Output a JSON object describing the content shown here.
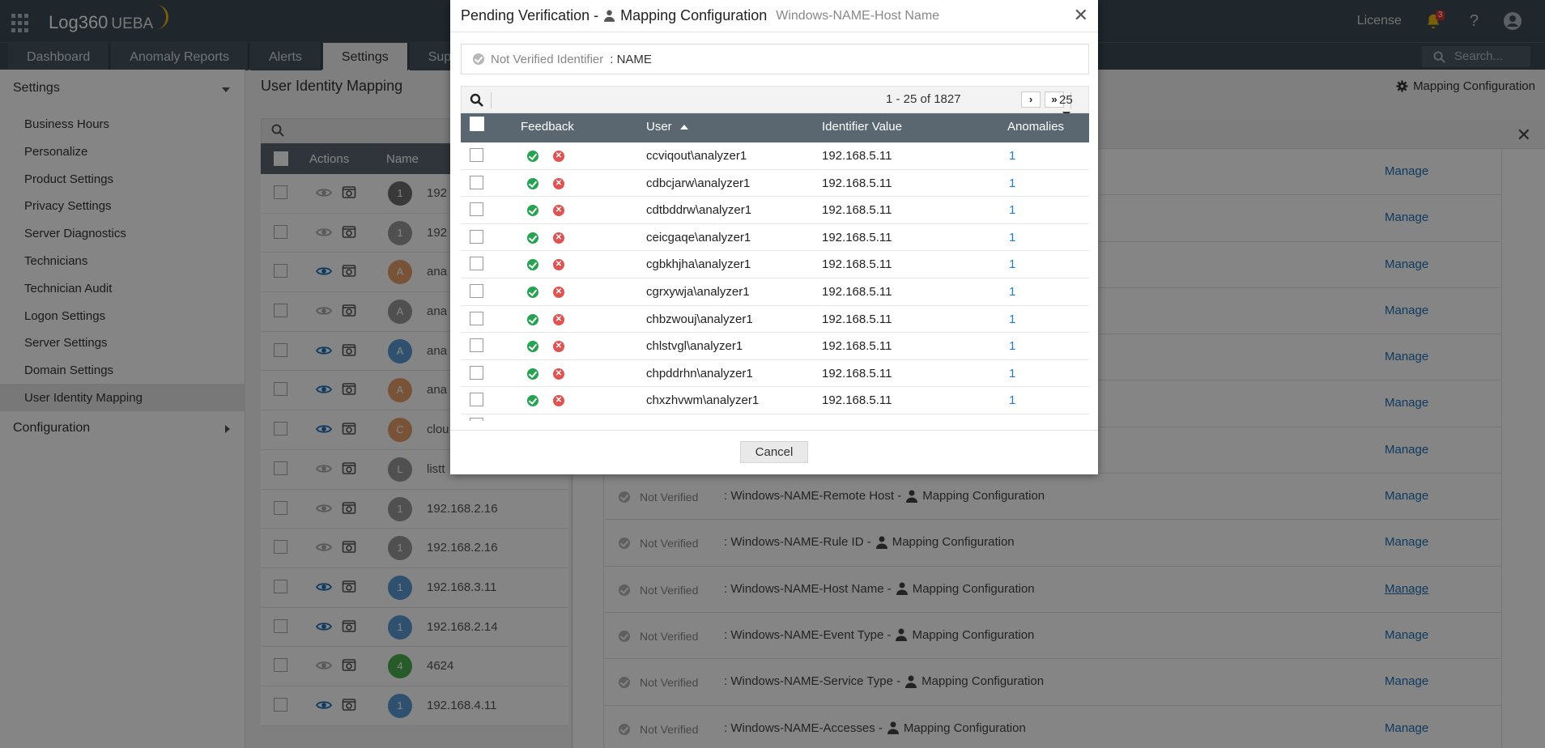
{
  "app": {
    "brand": "Log360",
    "brand_suffix": "UEBA"
  },
  "topbar": {
    "license": "License",
    "notification_count": "3",
    "help": "?"
  },
  "nav": {
    "tabs": [
      "Dashboard",
      "Anomaly Reports",
      "Alerts",
      "Settings",
      "Sup"
    ],
    "active": "Settings",
    "search_placeholder": "Search..."
  },
  "sidebar": {
    "heading": "Settings",
    "items": [
      "Business Hours",
      "Personalize",
      "Product Settings",
      "Privacy Settings",
      "Server Diagnostics",
      "Technicians",
      "Technician Audit",
      "Logon Settings",
      "Server Settings",
      "Domain Settings",
      "User Identity Mapping"
    ],
    "active_item": "User Identity Mapping",
    "configuration": "Configuration"
  },
  "main": {
    "title": "User Identity Mapping",
    "mapping_config_link": "Mapping Configuration",
    "grid_headers": {
      "actions": "Actions",
      "name": "Name"
    },
    "grid_rows": [
      {
        "avatar": "1",
        "name": "192",
        "color": "#6d6d6d"
      },
      {
        "avatar": "1",
        "name": "192",
        "color": "#9a9a9a"
      },
      {
        "avatar": "A",
        "name": "ana",
        "color": "#e8a06c"
      },
      {
        "avatar": "A",
        "name": "ana",
        "color": "#9a9a9a"
      },
      {
        "avatar": "A",
        "name": "ana",
        "color": "#5b9bd5"
      },
      {
        "avatar": "A",
        "name": "ana",
        "color": "#e8a06c"
      },
      {
        "avatar": "C",
        "name": "clou",
        "color": "#e8a06c"
      },
      {
        "avatar": "L",
        "name": "listt",
        "color": "#9a9a9a"
      },
      {
        "avatar": "1",
        "name": "192.168.2.16",
        "color": "#9a9a9a"
      },
      {
        "avatar": "1",
        "name": "192.168.2.16",
        "color": "#9a9a9a"
      },
      {
        "avatar": "1",
        "name": "192.168.3.11",
        "color": "#5b9bd5"
      },
      {
        "avatar": "1",
        "name": "192.168.2.14",
        "color": "#5b9bd5"
      },
      {
        "avatar": "4",
        "name": "4624",
        "color": "#4caf50"
      },
      {
        "avatar": "1",
        "name": "192.168.4.11",
        "color": "#5b9bd5"
      }
    ]
  },
  "drawer": {
    "status_label": "Not Verified",
    "manage_label": "Manage",
    "rows": [
      {
        "identifier": "",
        "config": ""
      },
      {
        "identifier": "",
        "config": ""
      },
      {
        "identifier": "",
        "config": ""
      },
      {
        "identifier": "",
        "config": ""
      },
      {
        "identifier": "",
        "config": ""
      },
      {
        "identifier": "",
        "config": ""
      },
      {
        "identifier": "",
        "config": ""
      },
      {
        "identifier": ": Windows-NAME-Remote Host -",
        "config": "Mapping Configuration"
      },
      {
        "identifier": ": Windows-NAME-Rule ID -",
        "config": "Mapping Configuration"
      },
      {
        "identifier": ": Windows-NAME-Host Name -",
        "config": "Mapping Configuration"
      },
      {
        "identifier": ": Windows-NAME-Event Type -",
        "config": "Mapping Configuration"
      },
      {
        "identifier": ": Windows-NAME-Service Type -",
        "config": "Mapping Configuration"
      },
      {
        "identifier": ": Windows-NAME-Accesses -",
        "config": "Mapping Configuration"
      }
    ]
  },
  "modal": {
    "title": "Pending Verification -",
    "title_config": "Mapping Configuration",
    "subtitle": "Windows-NAME-Host Name",
    "identifier_label": "Not Verified Identifier",
    "identifier_value": ": NAME",
    "range": "1 - 25 of 1827",
    "next": "›",
    "last": "»",
    "page_size": "25",
    "headers": {
      "feedback": "Feedback",
      "user": "User",
      "identifier": "Identifier Value",
      "anomalies": "Anomalies"
    },
    "rows": [
      {
        "user": "ccviqout\\analyzer1",
        "ip": "192.168.5.11",
        "anomalies": "1"
      },
      {
        "user": "cdbcjarw\\analyzer1",
        "ip": "192.168.5.11",
        "anomalies": "1"
      },
      {
        "user": "cdtbddrw\\analyzer1",
        "ip": "192.168.5.11",
        "anomalies": "1"
      },
      {
        "user": "ceicgaqe\\analyzer1",
        "ip": "192.168.5.11",
        "anomalies": "1"
      },
      {
        "user": "cgbkhjha\\analyzer1",
        "ip": "192.168.5.11",
        "anomalies": "1"
      },
      {
        "user": "cgrxywja\\analyzer1",
        "ip": "192.168.5.11",
        "anomalies": "1"
      },
      {
        "user": "chbzwouj\\analyzer1",
        "ip": "192.168.5.11",
        "anomalies": "1"
      },
      {
        "user": "chlstvgl\\analyzer1",
        "ip": "192.168.5.11",
        "anomalies": "1"
      },
      {
        "user": "chpddrhn\\analyzer1",
        "ip": "192.168.5.11",
        "anomalies": "1"
      },
      {
        "user": "chxzhvwm\\analyzer1",
        "ip": "192.168.5.11",
        "anomalies": "1"
      }
    ],
    "cancel": "Cancel"
  }
}
